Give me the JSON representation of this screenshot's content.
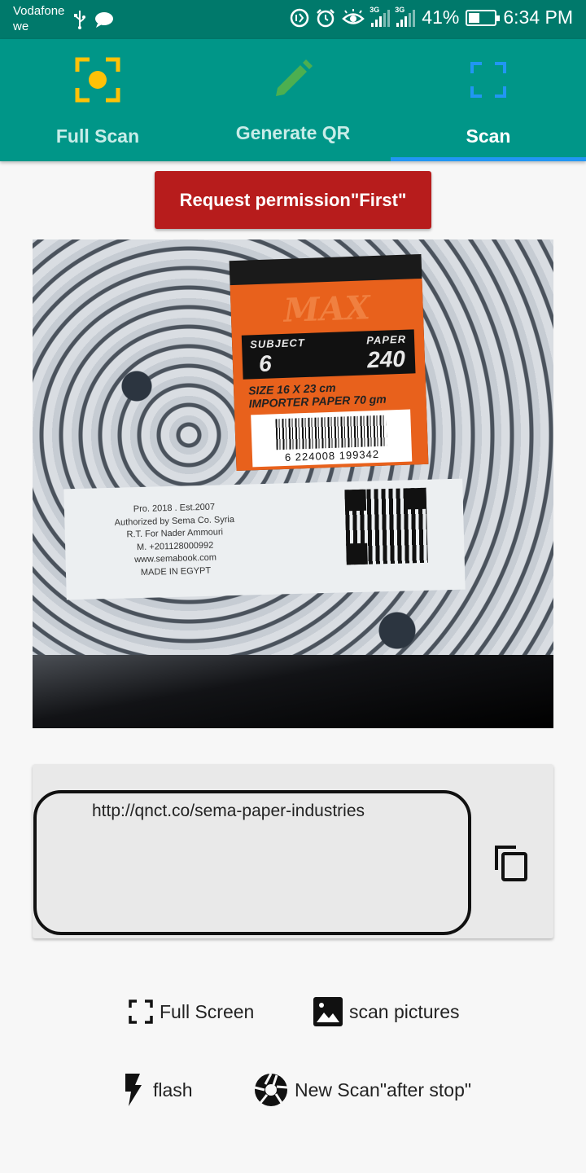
{
  "status_bar": {
    "carrier_line1": "Vodafone",
    "carrier_line2": "we",
    "network_1": "3G",
    "network_2": "3G",
    "battery": "41%",
    "battery_level": 0.41,
    "time": "6:34 PM"
  },
  "tabs": [
    {
      "label": "Full Scan",
      "icon": "fullscan-icon",
      "icon_color": "#ffc107"
    },
    {
      "label": "Generate QR",
      "icon": "pencil-icon",
      "icon_color": "#4caf50"
    },
    {
      "label": "Scan",
      "icon": "scan-frame-icon",
      "icon_color": "#2196f3",
      "active": true
    }
  ],
  "permission_button": {
    "label": "Request permission\"First\"",
    "color": "#b71c1c"
  },
  "camera_preview": {
    "product": {
      "brand": "MAX",
      "subject_label": "SUBJECT",
      "paper_label": "PAPER",
      "subject_value": "6",
      "paper_value": "240",
      "size_line": "SIZE 16 X 23 cm",
      "paper_line": "IMPORTER PAPER 70 gm",
      "barcode_number": "6 224008 199342"
    },
    "label_text": [
      "Pro. 2018 . Est.2007",
      "Authorized by Sema Co. Syria",
      "R.T. For Nader Ammouri",
      "M. +201128000992",
      "www.semabook.com",
      "MADE IN EGYPT"
    ]
  },
  "result": {
    "text": "http://qnct.co/sema-paper-industries"
  },
  "actions": {
    "full_screen": "Full Screen",
    "scan_pictures": "scan pictures",
    "flash": "flash",
    "new_scan": "New Scan\"after stop\""
  },
  "colors": {
    "primary": "#009688",
    "primary_dark": "#00796b",
    "indicator": "#2196f3"
  }
}
